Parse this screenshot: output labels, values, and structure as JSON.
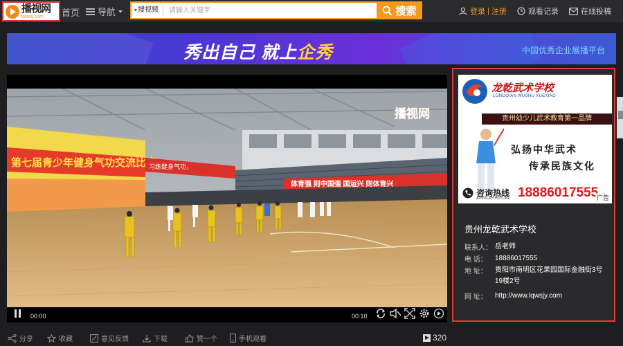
{
  "header": {
    "logo_cn": "播视网",
    "logo_en": "boosj.com",
    "nav_home": "首页",
    "nav_guide": "导航",
    "search_scope": "搜视频",
    "search_placeholder": "请输入关键字",
    "search_button": "搜索",
    "login": "登录",
    "register": "注册",
    "history": "观看记录",
    "upload": "在线投稿"
  },
  "banner": {
    "slogan_a": "秀出自己  就上",
    "slogan_b": "企秀",
    "subtitle": "中国优秀企业展播平台"
  },
  "video": {
    "watermark": "播视网",
    "current_time": "00:00",
    "duration": "00:10",
    "progress": 0,
    "scene_banner_left": "第七届青少年健身气功交流比赛",
    "scene_banner_slogan": "习练健身气功，",
    "scene_banner_right": "体育强  则中国强  国运兴  则体育兴"
  },
  "ad": {
    "title": "龙乾武术学校",
    "title_en": "LONGQIAN WUSHU XUEXIAO",
    "strip": "贵州幼少儿武术教育第一品牌",
    "calligraphy_1": "弘扬中华武术",
    "calligraphy_2": "传承民族文化",
    "hotline_cn": "咨询热线",
    "hotline_en": "ADVISORY HOTLINE",
    "phone": "18886017555",
    "tag": "广告"
  },
  "company": {
    "name": "贵州龙乾武术学校",
    "contact_label": "联系人：",
    "contact": "岳老师",
    "phone_label": "电    话：",
    "phone": "18886017555",
    "address_label": "地    址：",
    "address_line1": "贵阳市南明区花果园国际金融街3号",
    "address_line2": "19楼2号",
    "web_label": "网    址：",
    "website": "http://www.lqwsjy.com"
  },
  "actions": {
    "share": "分享",
    "favorite": "收藏",
    "feedback": "意见反馈",
    "download": "下载",
    "like": "赞一个",
    "mobile": "手机观看",
    "views": "320"
  },
  "colors": {
    "accent": "#f39a1e",
    "highlight_border": "#e23a3a"
  }
}
